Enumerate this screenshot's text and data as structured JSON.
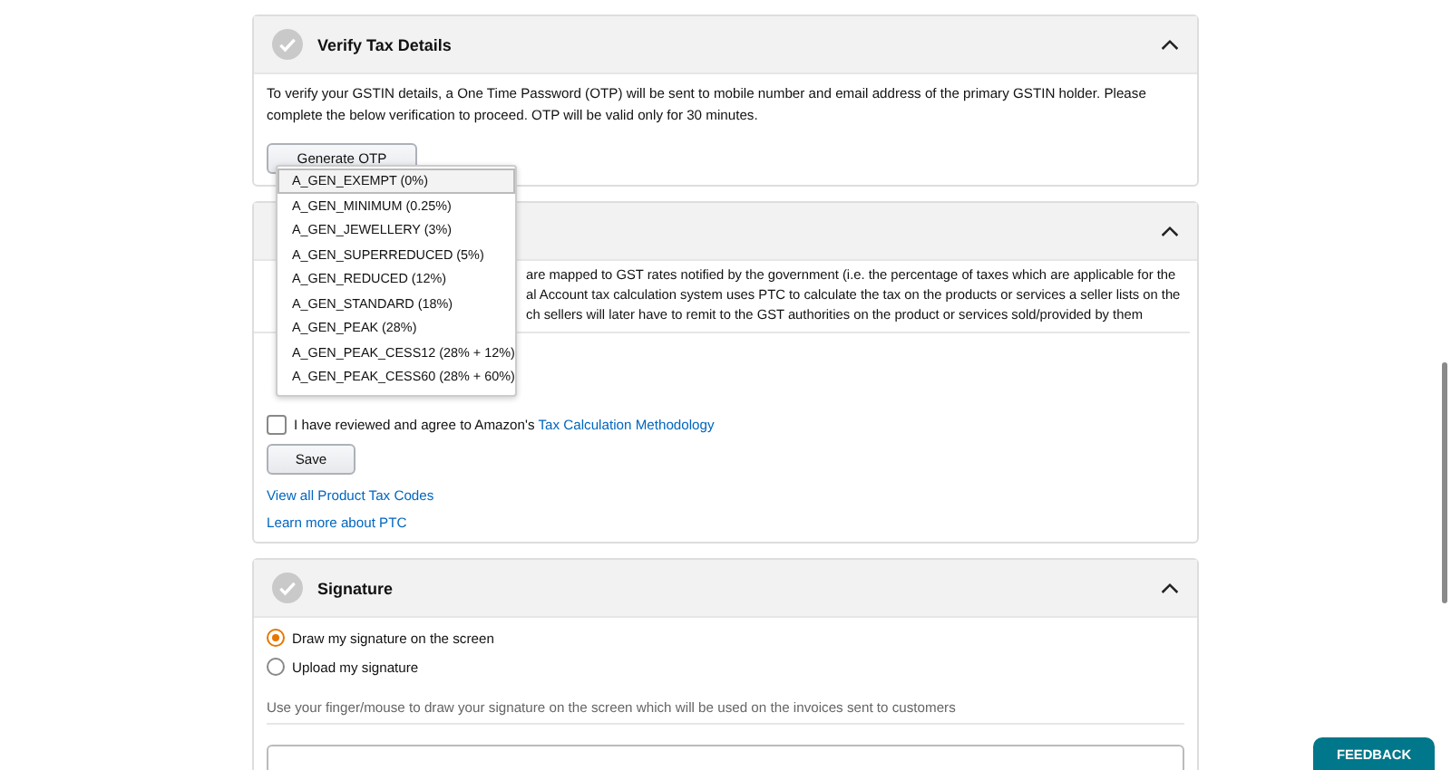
{
  "verify": {
    "title": "Verify Tax Details",
    "text": "To verify your GSTIN details, a One Time Password (OTP) will be sent to mobile number and email address of the primary GSTIN holder. Please complete the below verification to proceed. OTP will be valid only for 30 minutes.",
    "button": "Generate OTP"
  },
  "ptc": {
    "text_lines": [
      "are mapped to GST rates notified by the government (i.e. the percentage of taxes which are applicable for the",
      "al Account tax calculation system uses PTC to calculate the tax on the products or services a seller lists on the",
      "ch sellers will later have to remit to the GST authorities on the product or services sold/provided by them"
    ],
    "agree": {
      "checked": false,
      "label": "I have reviewed and agree to Amazon's ",
      "link": "Tax Calculation Methodology"
    },
    "button": "Save",
    "links": [
      "View all Product Tax Codes",
      "Learn more about PTC"
    ]
  },
  "dropdown": {
    "options": [
      {
        "label": "A_GEN_EXEMPT (0%)",
        "selected": true
      },
      {
        "label": "A_GEN_MINIMUM (0.25%)",
        "selected": false
      },
      {
        "label": "A_GEN_JEWELLERY (3%)",
        "selected": false
      },
      {
        "label": "A_GEN_SUPERREDUCED (5%)",
        "selected": false
      },
      {
        "label": "A_GEN_REDUCED (12%)",
        "selected": false
      },
      {
        "label": "A_GEN_STANDARD (18%)",
        "selected": false
      },
      {
        "label": "A_GEN_PEAK (28%)",
        "selected": false
      },
      {
        "label": "A_GEN_PEAK_CESS12 (28% + 12%)",
        "selected": false
      },
      {
        "label": "A_GEN_PEAK_CESS60 (28% + 60%)",
        "selected": false
      }
    ]
  },
  "signature": {
    "title": "Signature",
    "options": [
      {
        "label": "Draw my signature on the screen",
        "selected": true
      },
      {
        "label": "Upload my signature",
        "selected": false
      }
    ],
    "hint": "Use your finger/mouse to draw your signature on the screen which will be used on the invoices sent to customers"
  },
  "feedback": "FEEDBACK"
}
